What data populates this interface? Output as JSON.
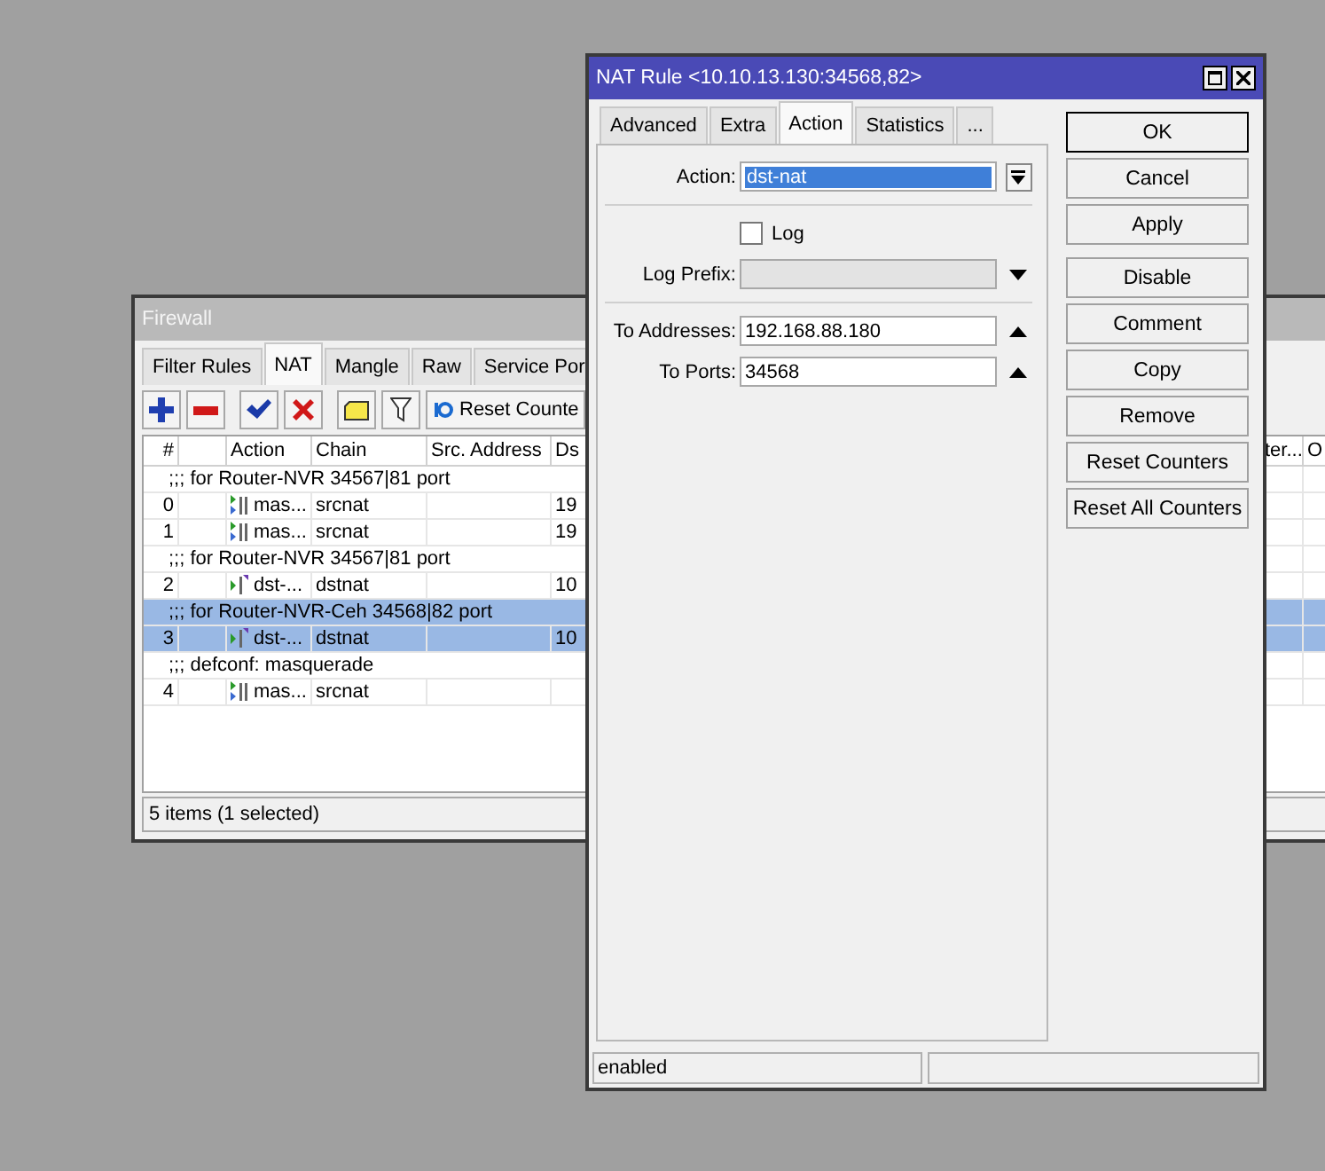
{
  "firewall": {
    "title": "Firewall",
    "tabs": [
      {
        "label": "Filter Rules",
        "selected": false
      },
      {
        "label": "NAT",
        "selected": true
      },
      {
        "label": "Mangle",
        "selected": false
      },
      {
        "label": "Raw",
        "selected": false
      },
      {
        "label": "Service Por",
        "selected": false
      }
    ],
    "toolbar": [
      {
        "kind": "add"
      },
      {
        "kind": "remove"
      },
      {
        "kind": "enable"
      },
      {
        "kind": "disable"
      },
      {
        "kind": "comment"
      },
      {
        "kind": "filter"
      },
      {
        "kind": "reset",
        "label": "Reset Counte"
      }
    ],
    "columns": [
      {
        "label": "#"
      },
      {
        "label": "Action"
      },
      {
        "label": "Chain"
      },
      {
        "label": "Src. Address"
      },
      {
        "label": "Ds"
      }
    ],
    "right_columns": [
      {
        "label": "ter..."
      },
      {
        "label": "O"
      }
    ],
    "rows": [
      {
        "kind": "comment",
        "text": ";;; for Router-NVR 34567|81 port",
        "selected": false
      },
      {
        "kind": "masquerade",
        "number": "0",
        "action": "mas...",
        "chain": "srcnat",
        "column_5": "19",
        "selected": false
      },
      {
        "kind": "masquerade",
        "number": "1",
        "action": "mas...",
        "chain": "srcnat",
        "column_5": "19",
        "selected": false
      },
      {
        "kind": "comment",
        "text": ";;; for Router-NVR 34567|81 port",
        "selected": false
      },
      {
        "kind": "dstnat",
        "number": "2",
        "action": "dst-...",
        "chain": "dstnat",
        "column_5": "10",
        "selected": false
      },
      {
        "kind": "comment",
        "text": ";;; for Router-NVR-Ceh 34568|82 port",
        "selected": true
      },
      {
        "kind": "dstnat",
        "number": "3",
        "action": "dst-...",
        "chain": "dstnat",
        "column_5": "10",
        "selected": true
      },
      {
        "kind": "comment",
        "text": ";;; defconf: masquerade",
        "selected": false
      },
      {
        "kind": "masquerade",
        "number": "4",
        "action": "mas...",
        "chain": "srcnat",
        "selected": false
      }
    ],
    "status": "5 items (1 selected)"
  },
  "dialog": {
    "title": "NAT Rule <10.10.13.130:34568,82>",
    "tabs": [
      {
        "label": "Advanced",
        "selected": false
      },
      {
        "label": "Extra",
        "selected": false
      },
      {
        "label": "Action",
        "selected": true
      },
      {
        "label": "Statistics",
        "selected": false
      },
      {
        "label": "...",
        "selected": false
      }
    ],
    "fields": [
      {
        "kind": "select",
        "label": "Action:",
        "value": "dst-nat"
      },
      {
        "kind": "divider"
      },
      {
        "kind": "checkbox",
        "label": "Log",
        "checked": false
      },
      {
        "kind": "text",
        "label": "Log Prefix:",
        "disabled": true,
        "expanded": false
      },
      {
        "kind": "divider"
      },
      {
        "kind": "text",
        "label": "To Addresses:",
        "value": "192.168.88.180",
        "disabled": false,
        "expanded": true
      },
      {
        "kind": "text",
        "label": "To Ports:",
        "value": "34568",
        "disabled": false,
        "expanded": true
      }
    ],
    "buttons": [
      {
        "label": "OK",
        "default": true
      },
      {
        "label": "Cancel",
        "default": false
      },
      {
        "label": "Apply",
        "default": false
      },
      {
        "label": "Disable",
        "default": false
      },
      {
        "label": "Comment",
        "default": false
      },
      {
        "label": "Copy",
        "default": false
      },
      {
        "label": "Remove",
        "default": false
      },
      {
        "label": "Reset Counters",
        "default": false
      },
      {
        "label": "Reset All Counters",
        "default": false
      }
    ],
    "status": "enabled"
  }
}
